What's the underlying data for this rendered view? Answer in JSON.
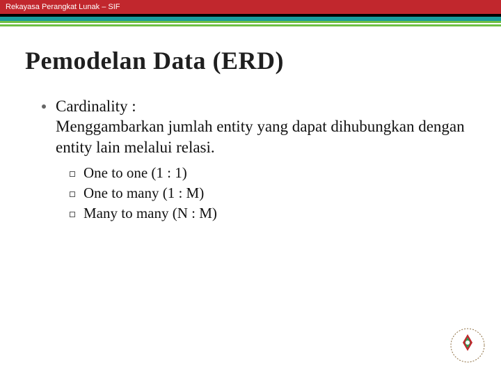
{
  "header": {
    "course": "Rekayasa Perangkat Lunak – SIF"
  },
  "slide": {
    "title": "Pemodelan Data (ERD)",
    "bullet": {
      "heading": "Cardinality :",
      "body": "Menggambarkan jumlah entity yang dapat dihubungkan dengan entity lain melalui relasi.",
      "items": [
        "One to one (1 : 1)",
        "One to many (1 : M)",
        "Many to many (N : M)"
      ]
    }
  }
}
